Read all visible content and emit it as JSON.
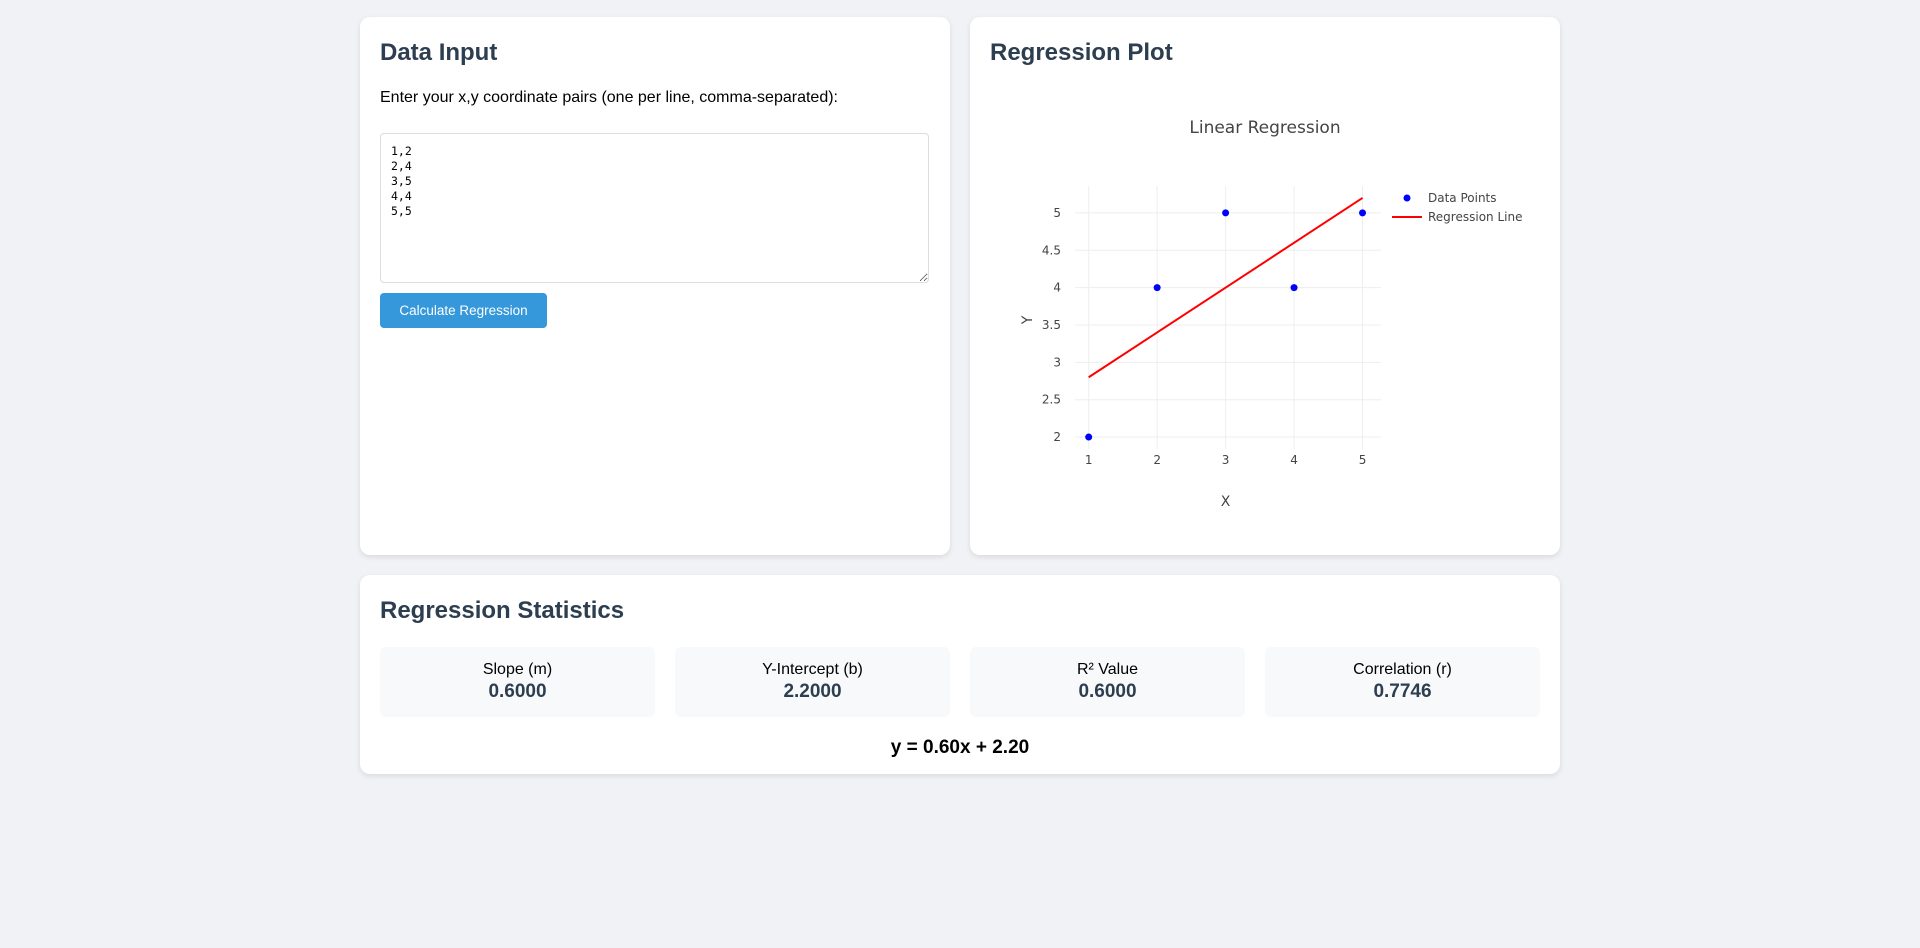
{
  "input_panel": {
    "title": "Data Input",
    "description": "Enter your x,y coordinate pairs (one per line, comma-separated):",
    "textarea_value": "1,2\n2,4\n3,5\n4,4\n5,5",
    "button_label": "Calculate Regression"
  },
  "plot_panel": {
    "title": "Regression Plot"
  },
  "chart_data": {
    "type": "scatter",
    "title": "Linear Regression",
    "xlabel": "X",
    "ylabel": "Y",
    "xlim": [
      0.8,
      5.27
    ],
    "ylim": [
      1.84,
      5.36
    ],
    "xticks": [
      1,
      2,
      3,
      4,
      5
    ],
    "yticks": [
      2,
      2.5,
      3,
      3.5,
      4,
      4.5,
      5
    ],
    "grid": true,
    "legend_position": "top-right",
    "series": [
      {
        "name": "Data Points",
        "kind": "markers",
        "color": "#0000ff",
        "x": [
          1,
          2,
          3,
          4,
          5
        ],
        "y": [
          2,
          4,
          5,
          4,
          5
        ]
      },
      {
        "name": "Regression Line",
        "kind": "line",
        "color": "#ff0000",
        "x": [
          1,
          5
        ],
        "y": [
          2.8,
          5.2
        ]
      }
    ]
  },
  "stats_panel": {
    "title": "Regression Statistics",
    "cards": [
      {
        "label": "Slope (m)",
        "value": "0.6000"
      },
      {
        "label": "Y-Intercept (b)",
        "value": "2.2000"
      },
      {
        "label": "R² Value",
        "value": "0.6000"
      },
      {
        "label": "Correlation (r)",
        "value": "0.7746"
      }
    ],
    "equation": "y = 0.60x + 2.20"
  }
}
